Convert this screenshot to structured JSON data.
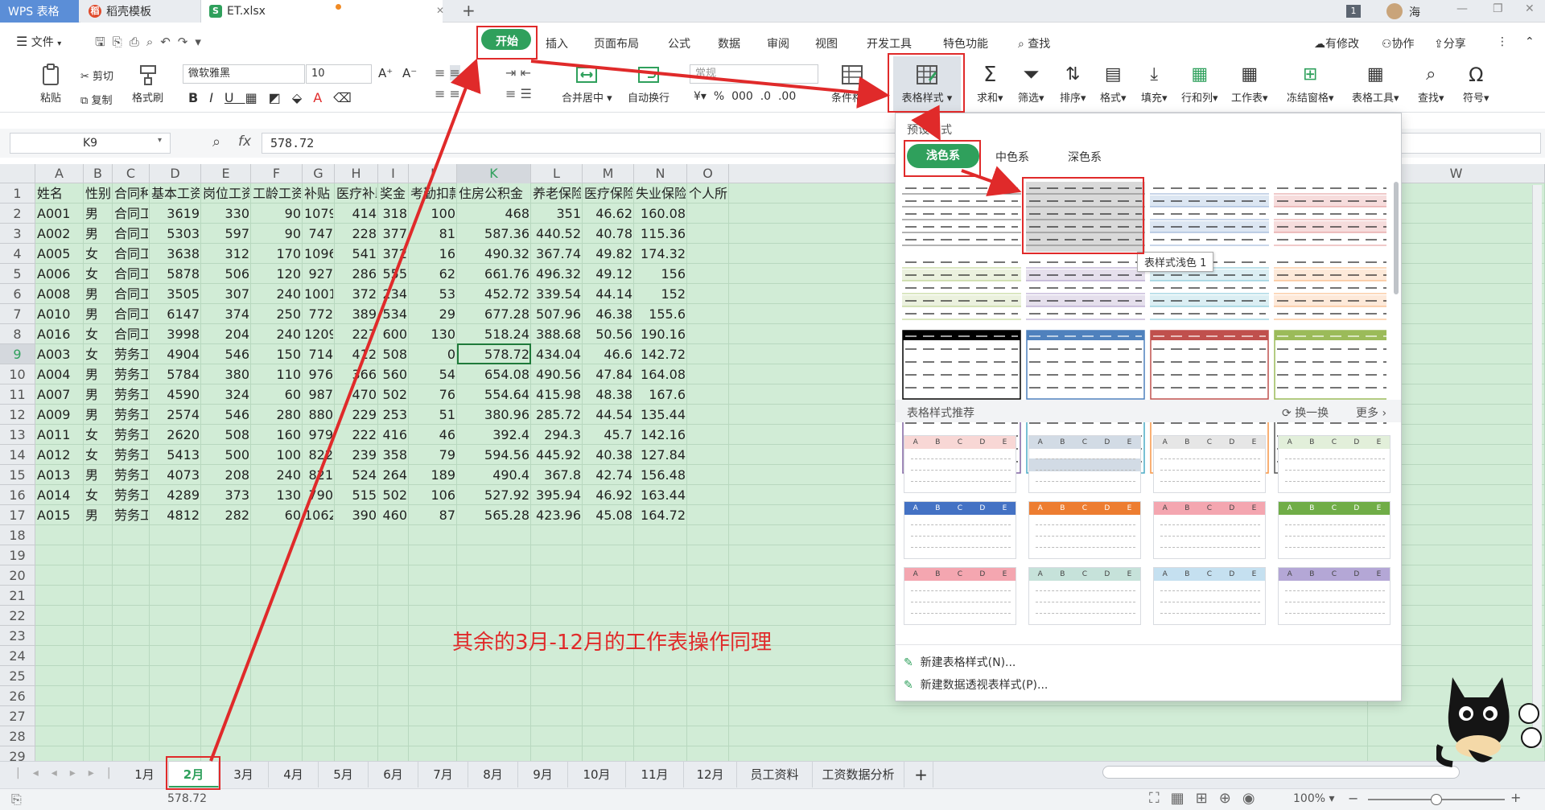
{
  "tabs": [
    {
      "label": "WPS 表格"
    },
    {
      "label": "稻壳模板"
    },
    {
      "label": "ET.xlsx"
    }
  ],
  "window": {
    "badge": "1",
    "user": "海"
  },
  "menu": {
    "file": "文件",
    "items": [
      "开始",
      "插入",
      "页面布局",
      "公式",
      "数据",
      "审阅",
      "视图",
      "开发工具",
      "特色功能"
    ],
    "search": "查找",
    "right": [
      "有修改",
      "协作",
      "分享"
    ]
  },
  "ribbon": {
    "paste": "粘贴",
    "cut": "剪切",
    "copy": "复制",
    "format_painter": "格式刷",
    "font_name": "微软雅黑",
    "font_size": "10",
    "merge": "合并居中",
    "wrap": "自动换行",
    "number_format": "常规",
    "cond_format": "条件格式",
    "table_style": "表格样式",
    "sum": "求和",
    "filter": "筛选",
    "sort": "排序",
    "format": "格式",
    "fill": "填充",
    "rowcol": "行和列",
    "sheet": "工作表",
    "freeze": "冻结窗格",
    "table_tools": "表格工具",
    "find": "查找",
    "symbol": "符号",
    "percent": "%",
    "thousand": "000"
  },
  "formula_bar": {
    "cell_ref": "K9",
    "fx": "fx",
    "value": "578.72"
  },
  "columns": [
    "A",
    "B",
    "C",
    "D",
    "E",
    "F",
    "G",
    "H",
    "I",
    "J",
    "K",
    "L",
    "M",
    "N",
    "O",
    "V",
    "W"
  ],
  "headers": [
    "姓名",
    "性别",
    "合同种类",
    "基本工资",
    "岗位工资",
    "工龄工资",
    "补贴",
    "医疗补助",
    "奖金",
    "考勤扣款",
    "住房公积金",
    "养老保险",
    "医疗保险",
    "失业保险",
    "个人所得"
  ],
  "rows": [
    [
      "A001",
      "男",
      "合同工",
      "3619",
      "330",
      "90",
      "1079",
      "414",
      "318",
      "100",
      "468",
      "351",
      "46.62",
      "160.08"
    ],
    [
      "A002",
      "男",
      "合同工",
      "5303",
      "597",
      "90",
      "747",
      "228",
      "377",
      "81",
      "587.36",
      "440.52",
      "40.78",
      "115.36"
    ],
    [
      "A005",
      "女",
      "合同工",
      "3638",
      "312",
      "170",
      "1096",
      "541",
      "372",
      "16",
      "490.32",
      "367.74",
      "49.82",
      "174.32"
    ],
    [
      "A006",
      "女",
      "合同工",
      "5878",
      "506",
      "120",
      "927",
      "286",
      "555",
      "62",
      "661.76",
      "496.32",
      "49.12",
      "156"
    ],
    [
      "A008",
      "男",
      "合同工",
      "3505",
      "307",
      "240",
      "1001",
      "372",
      "234",
      "53",
      "452.72",
      "339.54",
      "44.14",
      "152"
    ],
    [
      "A010",
      "男",
      "合同工",
      "6147",
      "374",
      "250",
      "772",
      "389",
      "534",
      "29",
      "677.28",
      "507.96",
      "46.38",
      "155.6"
    ],
    [
      "A016",
      "女",
      "合同工",
      "3998",
      "204",
      "240",
      "1209",
      "227",
      "600",
      "130",
      "518.24",
      "388.68",
      "50.56",
      "190.16"
    ],
    [
      "A003",
      "女",
      "劳务工",
      "4904",
      "546",
      "150",
      "714",
      "412",
      "508",
      "0",
      "578.72",
      "434.04",
      "46.6",
      "142.72"
    ],
    [
      "A004",
      "男",
      "劳务工",
      "5784",
      "380",
      "110",
      "976",
      "366",
      "560",
      "54",
      "654.08",
      "490.56",
      "47.84",
      "164.08"
    ],
    [
      "A007",
      "男",
      "劳务工",
      "4590",
      "324",
      "60",
      "987",
      "470",
      "502",
      "76",
      "554.64",
      "415.98",
      "48.38",
      "167.6"
    ],
    [
      "A009",
      "男",
      "劳务工",
      "2574",
      "546",
      "280",
      "880",
      "229",
      "253",
      "51",
      "380.96",
      "285.72",
      "44.54",
      "135.44"
    ],
    [
      "A011",
      "女",
      "劳务工",
      "2620",
      "508",
      "160",
      "979",
      "222",
      "416",
      "46",
      "392.4",
      "294.3",
      "45.7",
      "142.16"
    ],
    [
      "A012",
      "女",
      "劳务工",
      "5413",
      "500",
      "100",
      "822",
      "239",
      "358",
      "79",
      "594.56",
      "445.92",
      "40.38",
      "127.84"
    ],
    [
      "A013",
      "男",
      "劳务工",
      "4073",
      "208",
      "240",
      "821",
      "524",
      "264",
      "189",
      "490.4",
      "367.8",
      "42.74",
      "156.48"
    ],
    [
      "A014",
      "女",
      "劳务工",
      "4289",
      "373",
      "130",
      "790",
      "515",
      "502",
      "106",
      "527.92",
      "395.94",
      "46.92",
      "163.44"
    ],
    [
      "A015",
      "男",
      "劳务工",
      "4812",
      "282",
      "60",
      "1062",
      "390",
      "460",
      "87",
      "565.28",
      "423.96",
      "45.08",
      "164.72"
    ]
  ],
  "row_numbers": [
    "1",
    "2",
    "3",
    "4",
    "5",
    "6",
    "7",
    "8",
    "9",
    "10",
    "11",
    "12",
    "13",
    "14",
    "15",
    "16",
    "17",
    "18",
    "19",
    "20",
    "21",
    "22",
    "23",
    "24",
    "25",
    "26",
    "27",
    "28",
    "29"
  ],
  "annotation": "其余的3月-12月的工作表操作同理",
  "panel": {
    "preset_title": "预设样式",
    "tabs": [
      "浅色系",
      "中色系",
      "深色系"
    ],
    "tooltip": "表样式浅色 1",
    "recommend_title": "表格样式推荐",
    "refresh": "换一换",
    "more": "更多",
    "new_table_style": "新建表格样式(N)...",
    "new_pivot_style": "新建数据透视表样式(P)...",
    "mini_headers": [
      "A",
      "B",
      "C",
      "D",
      "E"
    ]
  },
  "sheets": [
    "1月",
    "2月",
    "3月",
    "4月",
    "5月",
    "6月",
    "7月",
    "8月",
    "9月",
    "10月",
    "11月",
    "12月",
    "员工资料",
    "工资数据分析"
  ],
  "status": {
    "value": "578.72",
    "zoom": "100%"
  },
  "colors": {
    "accent_green": "#2fa05c",
    "wps_blue": "#5b8ed7",
    "grid_green": "#d1ecd6",
    "red": "#e02a2a"
  }
}
